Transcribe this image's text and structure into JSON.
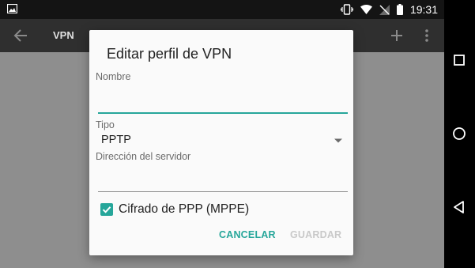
{
  "status_bar": {
    "time": "19:31",
    "icons": [
      "image-notification-icon",
      "vibrate-icon",
      "wifi-icon",
      "no-signal-icon",
      "battery-icon"
    ]
  },
  "app_bar": {
    "title": "VPN",
    "icons": [
      "back-arrow-icon",
      "add-icon",
      "more-vert-icon"
    ]
  },
  "dialog": {
    "title": "Editar perfil de VPN",
    "name_label": "Nombre",
    "name_value": "",
    "type_label": "Tipo",
    "type_value": "PPTP",
    "server_label": "Dirección del servidor",
    "server_value": "",
    "encryption_label": "Cifrado de PPP (MPPE)",
    "encryption_checked": true,
    "cancel_label": "CANCELAR",
    "save_label": "GUARDAR"
  },
  "navigation_bar": {
    "icons": [
      "recents-icon",
      "home-icon",
      "back-icon"
    ]
  },
  "colors": {
    "accent": "#26a69a",
    "disabled": "#c9c9c9",
    "app_bar": "#2f2f2f",
    "status_bar": "#141414"
  }
}
